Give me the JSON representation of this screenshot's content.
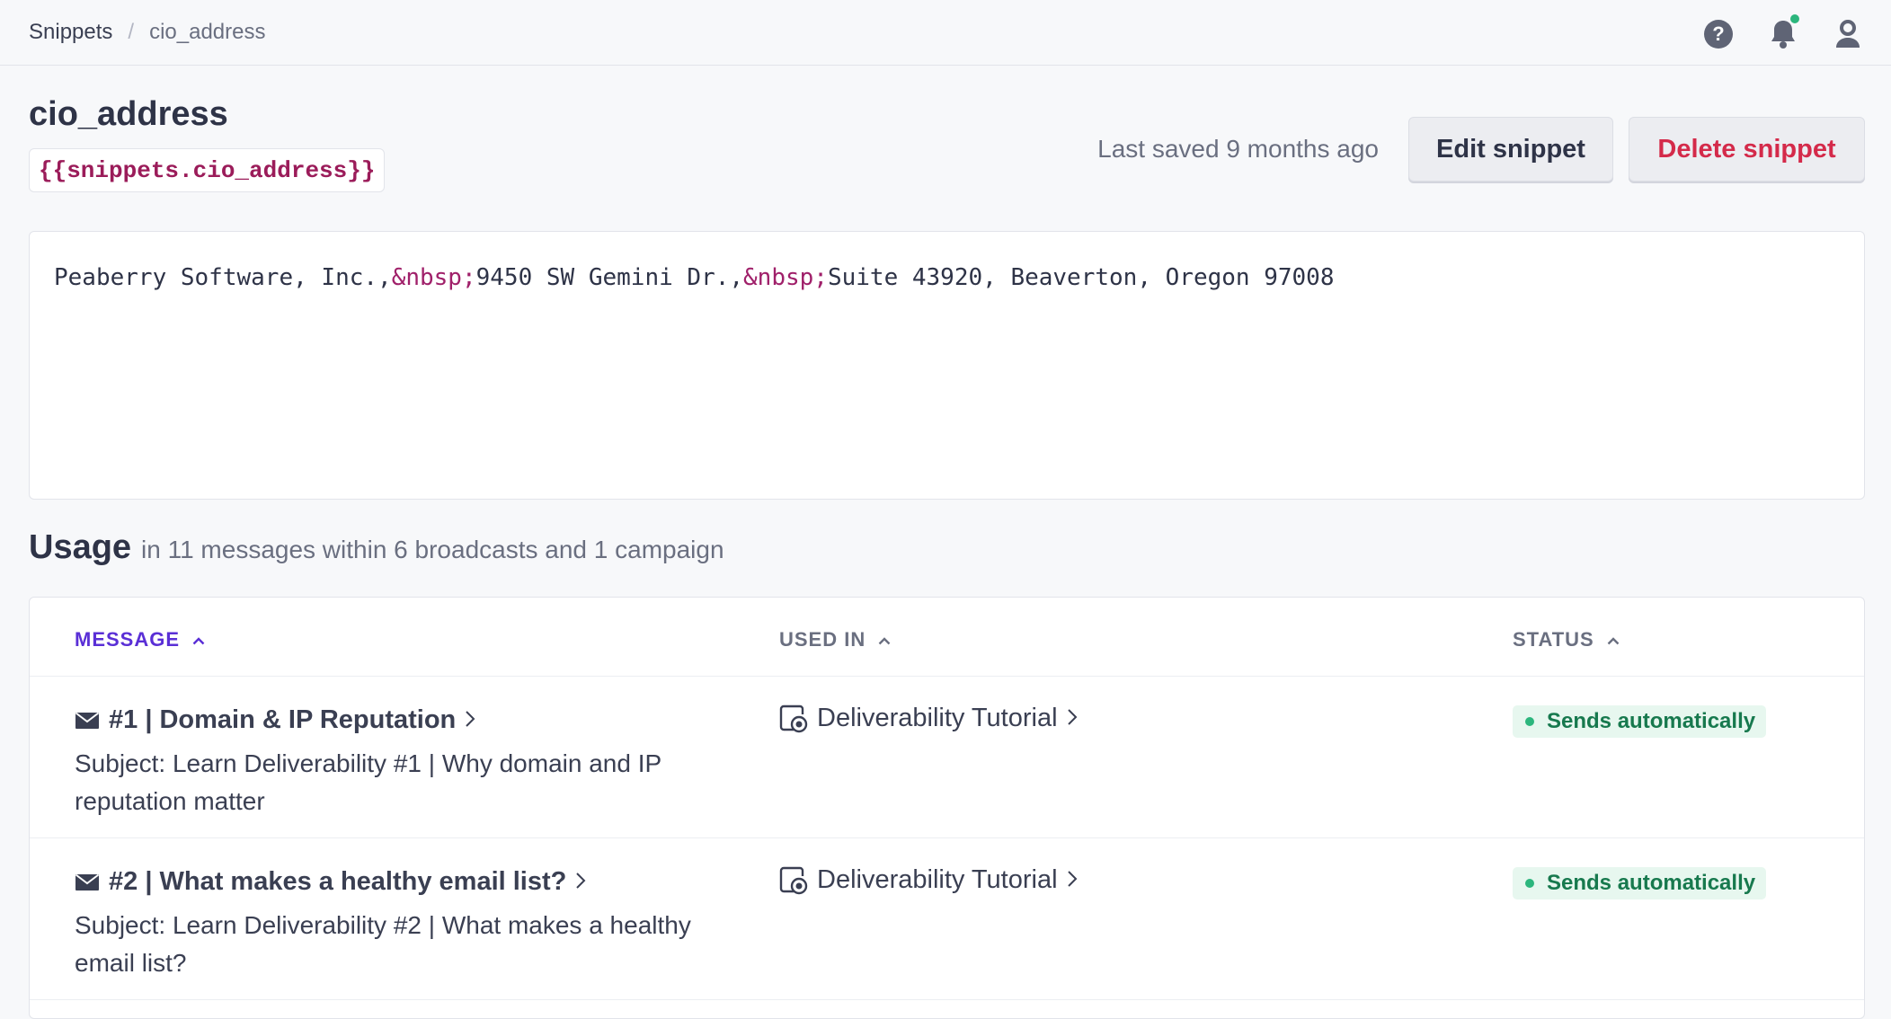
{
  "breadcrumb": {
    "parent": "Snippets",
    "separator": "/",
    "current": "cio_address"
  },
  "header_icons": [
    "help-icon",
    "bell-icon",
    "user-icon"
  ],
  "snippet": {
    "name": "cio_address",
    "liquid": "{{snippets.cio_address}}",
    "last_saved": "Last saved 9 months ago",
    "edit_label": "Edit snippet",
    "delete_label": "Delete snippet",
    "content_parts": [
      "Peaberry Software, Inc.,",
      "&nbsp;",
      "9450 SW Gemini Dr.,",
      "&nbsp;",
      "Suite 43920, Beaverton, Oregon 97008"
    ]
  },
  "usage": {
    "title": "Usage",
    "summary": "in 11 messages within 6 broadcasts and 1 campaign",
    "columns": {
      "message": "MESSAGE",
      "used_in": "USED IN",
      "status": "STATUS"
    },
    "rows": [
      {
        "title": "#1 | Domain & IP Reputation",
        "subject": "Subject: Learn Deliverability #1 | Why domain and IP reputation matter",
        "used_in": "Deliverability Tutorial",
        "status": "Sends automatically"
      },
      {
        "title": "#2 | What makes a healthy email list?",
        "subject": "Subject: Learn Deliverability #2 | What makes a healthy email list?",
        "used_in": "Deliverability Tutorial",
        "status": "Sends automatically"
      }
    ]
  },
  "colors": {
    "accent": "#5a2fd6",
    "danger": "#d42a4a",
    "success": "#2cb67d",
    "liquid": "#9b1c5a"
  }
}
